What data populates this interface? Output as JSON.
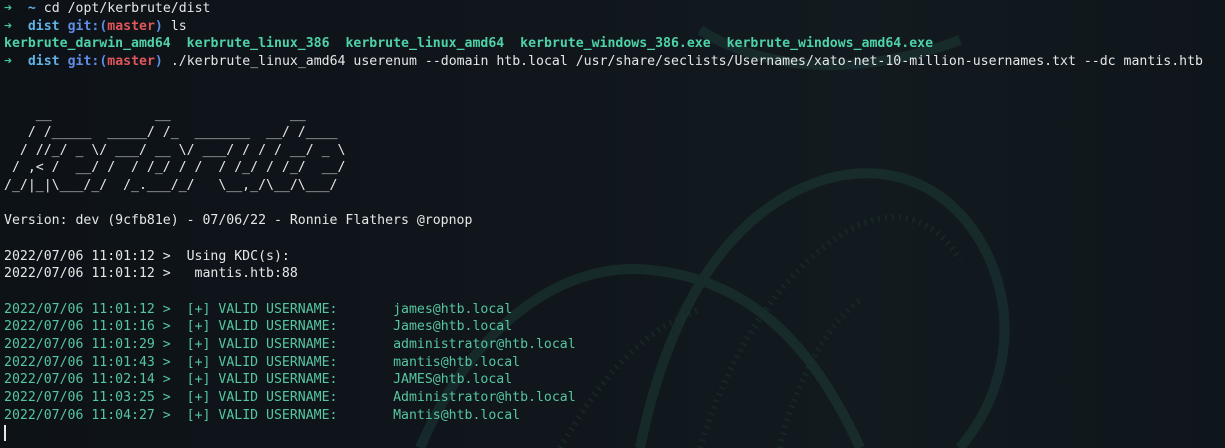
{
  "theme": {
    "background": "#0f1419",
    "prompt_arrow": "#3fc4a1",
    "dir": "#5fb3e6",
    "git": "#5f8de6",
    "branch": "#e0565b",
    "ls_item": "#4fd2a8",
    "valid_text": "#55c6a0"
  },
  "icons": {
    "prompt": "arrow-icon"
  },
  "prompt": {
    "arrow": "➜",
    "home": "~",
    "dir": "dist",
    "git_label": "git:(",
    "branch": "master",
    "git_close": ")"
  },
  "commands": {
    "cd": "cd /opt/kerbrute/dist",
    "ls": "ls",
    "run": "./kerbrute_linux_amd64 userenum --domain htb.local /usr/share/seclists/Usernames/xato-net-10-million-usernames.txt --dc mantis.htb"
  },
  "ls_output": [
    "kerbrute_darwin_amd64",
    "kerbrute_linux_386",
    "kerbrute_linux_amd64",
    "kerbrute_windows_386.exe",
    "kerbrute_windows_amd64.exe"
  ],
  "banner": [
    "    __             __               __     ",
    "   / /_____  _____/ /_  _______  __/ /____ ",
    "  / //_/ _ \\/ ___/ __ \\/ ___/ / / / __/ _ \\",
    " / ,< /  __/ /  / /_/ / /  / /_/ / /_/  __/",
    "/_/|_|\\___/_/  /_.___/_/   \\__,_/\\__/\\___/ "
  ],
  "version": "Version: dev (9cfb81e) - 07/06/22 - Ronnie Flathers @ropnop",
  "kdc": [
    "2022/07/06 11:01:12 >  Using KDC(s):",
    "2022/07/06 11:01:12 >   mantis.htb:88"
  ],
  "results": [
    {
      "ts": "2022/07/06 11:01:12 >",
      "tag": "[+] VALID USERNAME:",
      "user": "james@htb.local"
    },
    {
      "ts": "2022/07/06 11:01:16 >",
      "tag": "[+] VALID USERNAME:",
      "user": "James@htb.local"
    },
    {
      "ts": "2022/07/06 11:01:29 >",
      "tag": "[+] VALID USERNAME:",
      "user": "administrator@htb.local"
    },
    {
      "ts": "2022/07/06 11:01:43 >",
      "tag": "[+] VALID USERNAME:",
      "user": "mantis@htb.local"
    },
    {
      "ts": "2022/07/06 11:02:14 >",
      "tag": "[+] VALID USERNAME:",
      "user": "JAMES@htb.local"
    },
    {
      "ts": "2022/07/06 11:03:25 >",
      "tag": "[+] VALID USERNAME:",
      "user": "Administrator@htb.local"
    },
    {
      "ts": "2022/07/06 11:04:27 >",
      "tag": "[+] VALID USERNAME:",
      "user": "Mantis@htb.local"
    }
  ]
}
